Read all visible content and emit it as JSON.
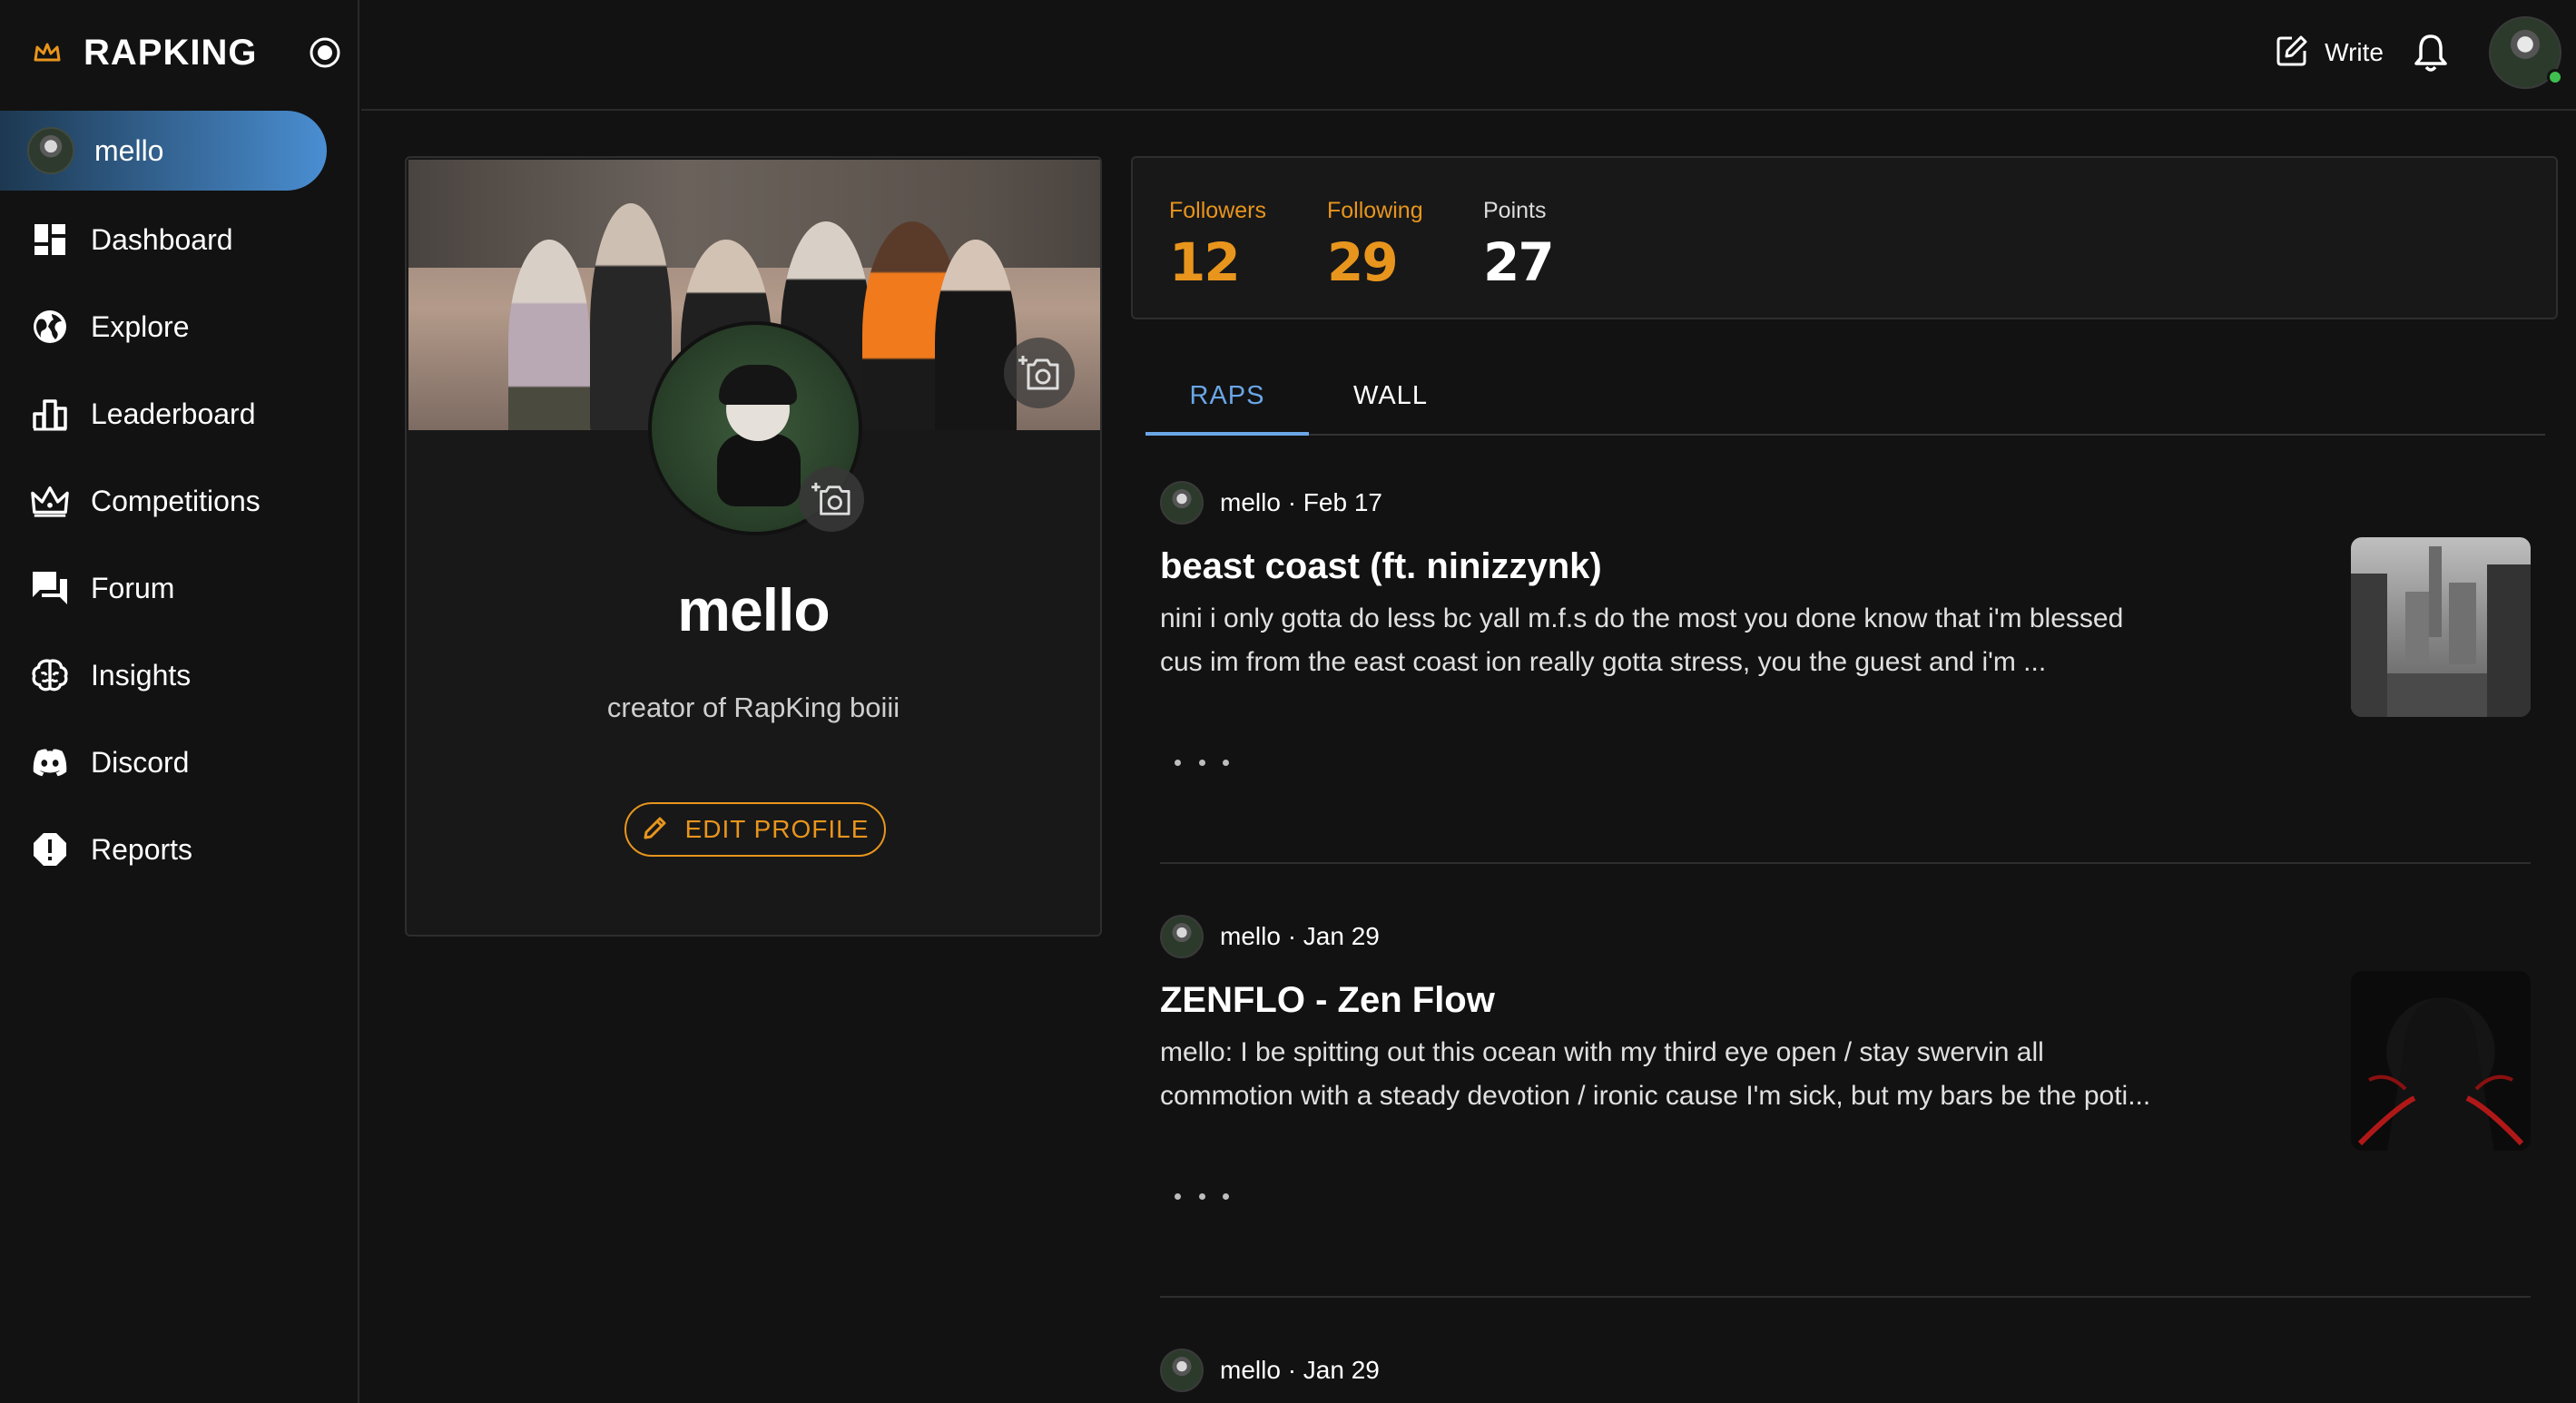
{
  "brand": {
    "name": "RAPKING",
    "accent": "#e8951d"
  },
  "sidebar": {
    "user_label": "mello",
    "items": [
      {
        "label": "Dashboard",
        "icon": "dashboard-icon"
      },
      {
        "label": "Explore",
        "icon": "globe-icon"
      },
      {
        "label": "Leaderboard",
        "icon": "leaderboard-icon"
      },
      {
        "label": "Competitions",
        "icon": "crown-icon"
      },
      {
        "label": "Forum",
        "icon": "forum-icon"
      },
      {
        "label": "Insights",
        "icon": "brain-icon"
      },
      {
        "label": "Discord",
        "icon": "discord-icon"
      },
      {
        "label": "Reports",
        "icon": "report-icon"
      }
    ]
  },
  "topbar": {
    "write_label": "Write",
    "status": "online"
  },
  "profile": {
    "name": "mello",
    "bio": "creator of RapKing boiii",
    "edit_label": "EDIT PROFILE"
  },
  "stats": {
    "followers_label": "Followers",
    "followers": "12",
    "following_label": "Following",
    "following": "29",
    "points_label": "Points",
    "points": "27",
    "label_color": "#e8951d",
    "value_color": "#e8951d",
    "points_color": "#ffffff"
  },
  "tabs": [
    {
      "label": "RAPS",
      "active": true
    },
    {
      "label": "WALL",
      "active": false
    }
  ],
  "posts": [
    {
      "meta": "mello · Feb 17",
      "title": "beast coast (ft. ninizzynk)",
      "excerpt_line1": "nini i only gotta do less bc yall m.f.s do the most you done know that i'm blessed",
      "excerpt_line2": "cus im from the east coast ion really gotta stress, you the guest and i'm ..."
    },
    {
      "meta": "mello · Jan 29",
      "title": "ZENFLO - Zen Flow",
      "excerpt_line1": "mello: I be spitting out this ocean with my third eye open / stay swervin all",
      "excerpt_line2": "commotion with a steady devotion / ironic cause I'm sick, but my bars be the poti..."
    },
    {
      "meta": "mello · Jan 29"
    }
  ],
  "colors": {
    "active_tab": "#6aa6e6",
    "background": "#121212",
    "card": "#181818"
  }
}
